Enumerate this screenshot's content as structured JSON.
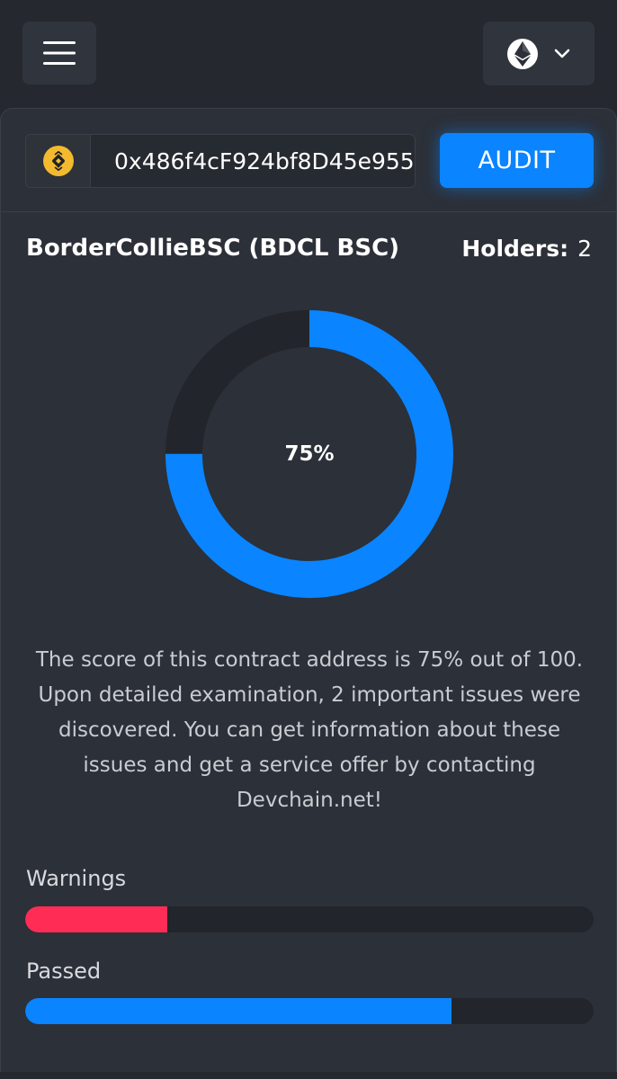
{
  "header": {
    "menu_icon": "hamburger-menu-icon",
    "network_icon": "ethereum-icon",
    "dropdown_icon": "chevron-down-icon"
  },
  "audit_form": {
    "chain_icon": "bnb-chain-icon",
    "address_value": "0x486f4cF924bf8D45e955",
    "audit_label": "AUDIT"
  },
  "token": {
    "name": "BorderCollieBSC (BDCL BSC)",
    "holders_label": "Holders:",
    "holders_value": "2"
  },
  "score": {
    "percent": 75,
    "label": "75%",
    "description": "The score of this contract address is 75% out of 100. Upon detailed examination, 2 important issues were discovered. You can get information about these issues and get a service offer by contacting Devchain.net!"
  },
  "metrics": [
    {
      "label": "Warnings",
      "fraction": 0.25,
      "color": "#ff2d55"
    },
    {
      "label": "Passed",
      "fraction": 0.75,
      "color": "#0a84ff"
    }
  ],
  "colors": {
    "accent": "#0a84ff",
    "warning": "#ff2d55",
    "track": "#22252b"
  }
}
